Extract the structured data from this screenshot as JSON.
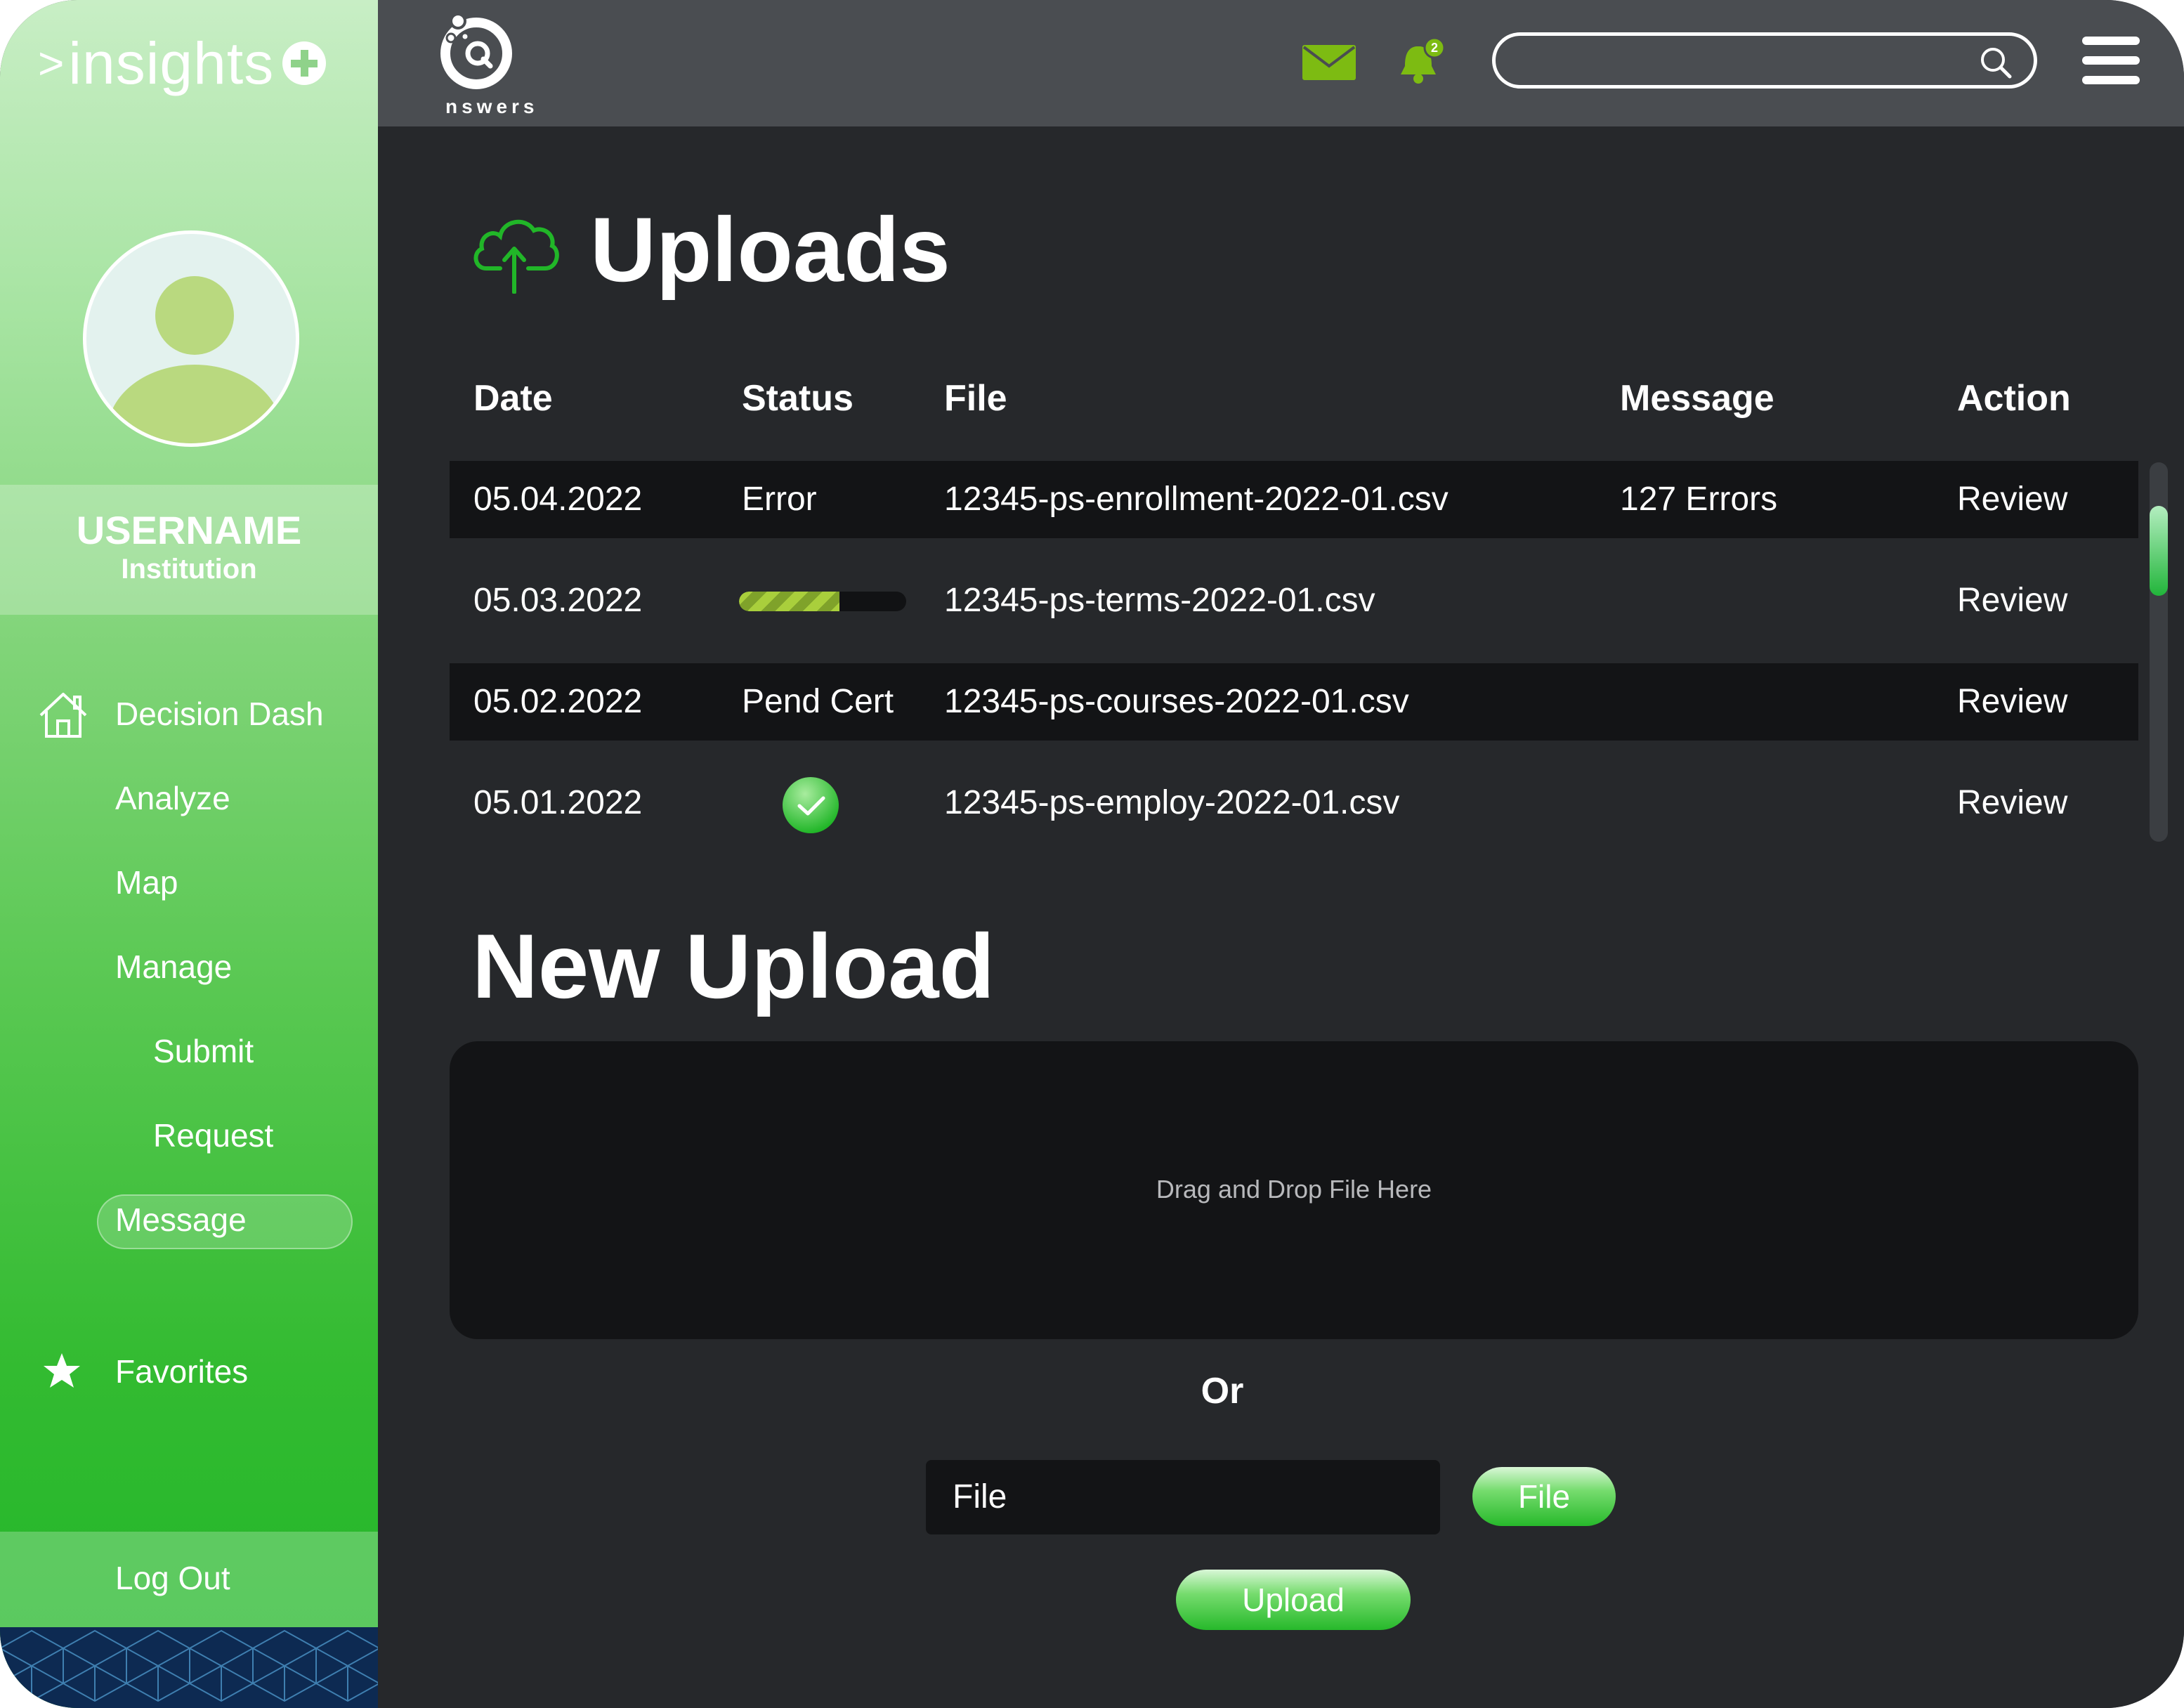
{
  "app": {
    "name": "insights",
    "logo_chevron": ">",
    "brand": "nswers"
  },
  "user": {
    "username": "USERNAME",
    "institution": "Institution"
  },
  "sidebar": {
    "items": [
      {
        "label": "Decision Dash"
      },
      {
        "label": "Analyze"
      },
      {
        "label": "Map"
      },
      {
        "label": "Manage"
      },
      {
        "label": "Submit"
      },
      {
        "label": "Request"
      },
      {
        "label": "Message",
        "active": true
      },
      {
        "label": "Favorites"
      }
    ],
    "logout": "Log Out"
  },
  "topbar": {
    "notification_count": "2",
    "search_placeholder": "",
    "icons": [
      "mail-icon",
      "bell-icon",
      "search-icon",
      "hamburger-menu-icon"
    ]
  },
  "uploads": {
    "title": "Uploads",
    "columns": [
      "Date",
      "Status",
      "File",
      "Message",
      "Action"
    ],
    "rows": [
      {
        "date": "05.04.2022",
        "status": "Error",
        "file": "12345-ps-enrollment-2022-01.csv",
        "message": "127 Errors",
        "action": "Review"
      },
      {
        "date": "05.03.2022",
        "status": "",
        "status_progress": 0.6,
        "file": "12345-ps-terms-2022-01.csv",
        "message": "",
        "action": "Review"
      },
      {
        "date": "05.02.2022",
        "status": "Pend Cert",
        "file": "12345-ps-courses-2022-01.csv",
        "message": "",
        "action": "Review"
      },
      {
        "date": "05.01.2022",
        "status": "",
        "status_icon": "check-circle-icon",
        "file": "12345-ps-employ-2022-01.csv",
        "message": "",
        "action": "Review"
      }
    ]
  },
  "new_upload": {
    "title": "New Upload",
    "dropzone": "Drag and Drop File Here",
    "or": "Or",
    "file_field": "File",
    "file_button": "File",
    "upload_button": "Upload"
  },
  "colors": {
    "accent_green": "#21b628",
    "mail_green": "#7dbb12",
    "background": "#26282b",
    "topbar": "#4a4d51",
    "row_dark": "#131416"
  }
}
